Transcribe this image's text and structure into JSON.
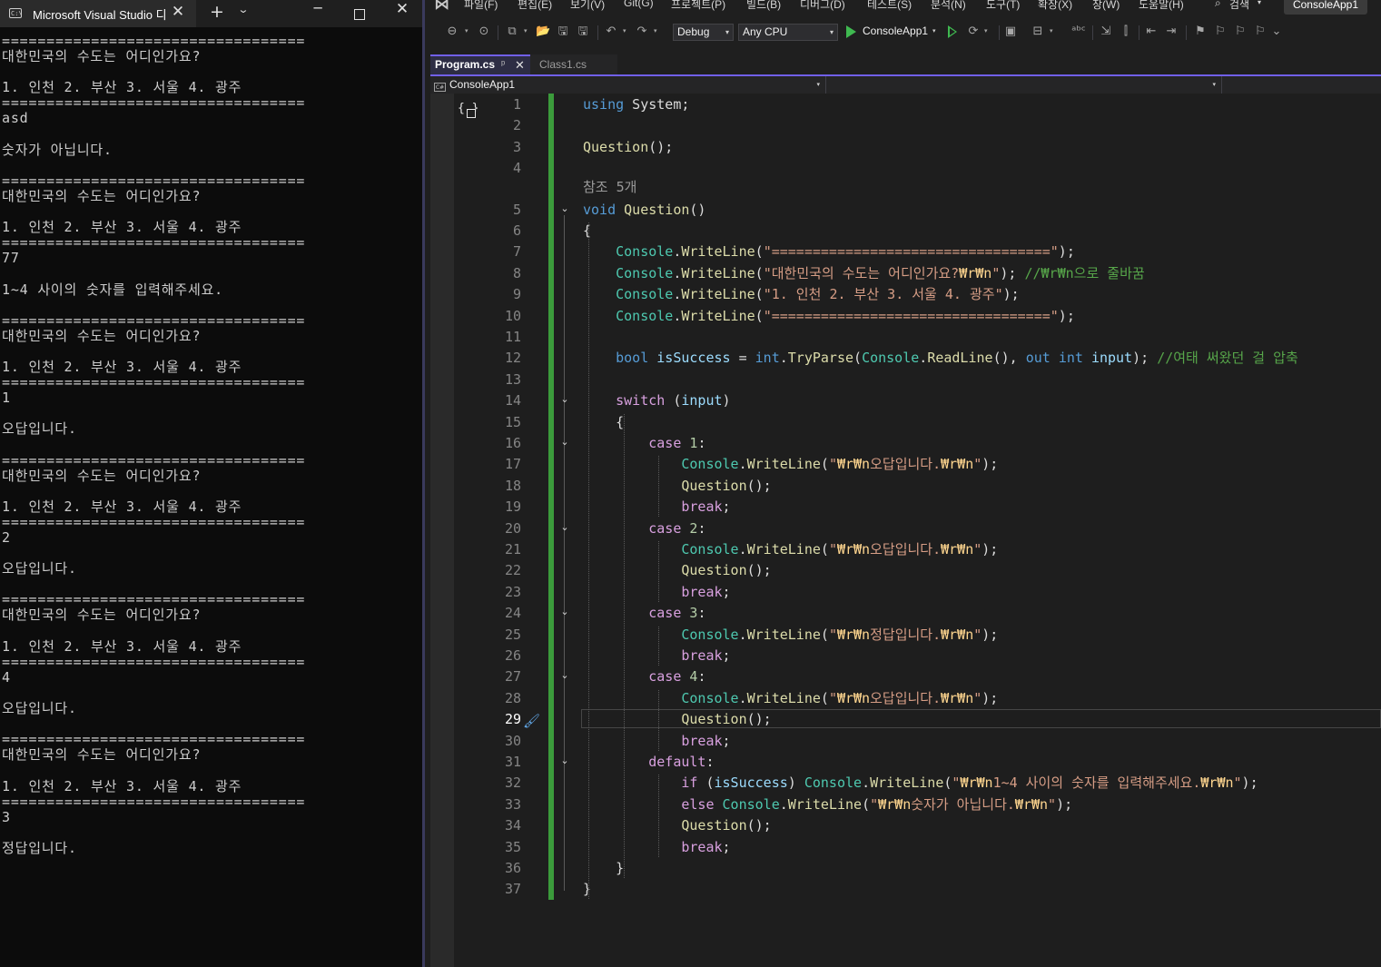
{
  "console": {
    "tab_title": "Microsoft Visual Studio 디",
    "tab_icon_text": "C:\\",
    "close_glyph": "✕",
    "new_tab_glyph": "+",
    "dropdown_glyph": "⌄",
    "minimize_glyph": "─",
    "close_window_glyph": "✕",
    "output": "==================================\n대한민국의 수도는 어디인가요?\n\n1. 인천 2. 부산 3. 서울 4. 광주\n==================================\nasd\n\n숫자가 아닙니다.\n\n==================================\n대한민국의 수도는 어디인가요?\n\n1. 인천 2. 부산 3. 서울 4. 광주\n==================================\n77\n\n1~4 사이의 숫자를 입력해주세요.\n\n==================================\n대한민국의 수도는 어디인가요?\n\n1. 인천 2. 부산 3. 서울 4. 광주\n==================================\n1\n\n오답입니다.\n\n==================================\n대한민국의 수도는 어디인가요?\n\n1. 인천 2. 부산 3. 서울 4. 광주\n==================================\n2\n\n오답입니다.\n\n==================================\n대한민국의 수도는 어디인가요?\n\n1. 인천 2. 부산 3. 서울 4. 광주\n==================================\n4\n\n오답입니다.\n\n==================================\n대한민국의 수도는 어디인가요?\n\n1. 인천 2. 부산 3. 서울 4. 광주\n==================================\n3\n\n정답입니다."
  },
  "vs": {
    "logo_glyph": "⋈",
    "menu": [
      "파일(F)",
      "편집(E)",
      "보기(V)",
      "Git(G)",
      "프로젝트(P)",
      "빌드(B)",
      "디버그(D)",
      "테스트(S)",
      "분석(N)",
      "도구(T)",
      "확장(X)",
      "창(W)",
      "도움말(H)"
    ],
    "search_label": "검색",
    "search_glyph": "⌕",
    "chev_glyph": "▾",
    "solution_name": "ConsoleApp1",
    "toolbar": {
      "config": "Debug",
      "platform": "Any CPU",
      "run_target": "ConsoleApp1",
      "icon_glyphs": {
        "back": "⊖",
        "forward": "⊙",
        "new_item": "⧉",
        "open": "📂",
        "save": "🖫",
        "save_all": "🖫",
        "undo": "↶",
        "redo": "↷",
        "attach": "⟳",
        "solution_explorer": "▣",
        "layout": "⊟",
        "spell": "ᵃᵇᶜ",
        "step": "⇲",
        "panes": "⫿",
        "indent": "⇤",
        "outdent": "⇥",
        "bookmark": "⚑",
        "prev_bookmark": "⚐",
        "next_bookmark": "⚐",
        "clear_bookmark": "⚐",
        "more": "⌄"
      }
    },
    "tabs": [
      {
        "label": "Program.cs",
        "pin": "ᵖ",
        "close": "✕"
      },
      {
        "label": "Class1.cs"
      }
    ],
    "nav": {
      "project": "ConsoleApp1",
      "cs_badge": "C#",
      "member": ""
    },
    "editor": {
      "gutter_glyph": "{ }",
      "codelens": "참조 5개",
      "current_line": 29,
      "line_numbers": [
        "1",
        "2",
        "3",
        "4",
        "5",
        "6",
        "7",
        "8",
        "9",
        "10",
        "11",
        "12",
        "13",
        "14",
        "15",
        "16",
        "17",
        "18",
        "19",
        "20",
        "21",
        "22",
        "23",
        "24",
        "25",
        "26",
        "27",
        "28",
        "29",
        "30",
        "31",
        "32",
        "33",
        "34",
        "35",
        "36",
        "37"
      ],
      "fold_glyph": "⌄",
      "brush_glyph": "🖌",
      "lines": [
        [
          [
            "kw",
            "using"
          ],
          [
            "pl",
            " System;"
          ]
        ],
        [],
        [
          [
            "mth",
            "Question"
          ],
          [
            "pl",
            "();"
          ]
        ],
        [],
        [
          [
            "kw",
            "void"
          ],
          [
            "pl",
            " "
          ],
          [
            "mth",
            "Question"
          ],
          [
            "pl",
            "()"
          ]
        ],
        [
          [
            "pl",
            "{"
          ]
        ],
        [
          [
            "pl",
            "    "
          ],
          [
            "cls",
            "Console"
          ],
          [
            "pl",
            "."
          ],
          [
            "mth",
            "WriteLine"
          ],
          [
            "pl",
            "("
          ],
          [
            "str",
            "\"==================================\""
          ],
          [
            "pl",
            ");"
          ]
        ],
        [
          [
            "pl",
            "    "
          ],
          [
            "cls",
            "Console"
          ],
          [
            "pl",
            "."
          ],
          [
            "mth",
            "WriteLine"
          ],
          [
            "pl",
            "("
          ],
          [
            "str",
            "\"대한민국의 수도는 어디인가요?"
          ],
          [
            "esc",
            "₩r₩n"
          ],
          [
            "str",
            "\""
          ],
          [
            "pl",
            "); "
          ],
          [
            "cmt",
            "//₩r₩n으로 줄바꿈"
          ]
        ],
        [
          [
            "pl",
            "    "
          ],
          [
            "cls",
            "Console"
          ],
          [
            "pl",
            "."
          ],
          [
            "mth",
            "WriteLine"
          ],
          [
            "pl",
            "("
          ],
          [
            "str",
            "\"1. 인천 2. 부산 3. 서울 4. 광주\""
          ],
          [
            "pl",
            ");"
          ]
        ],
        [
          [
            "pl",
            "    "
          ],
          [
            "cls",
            "Console"
          ],
          [
            "pl",
            "."
          ],
          [
            "mth",
            "WriteLine"
          ],
          [
            "pl",
            "("
          ],
          [
            "str",
            "\"==================================\""
          ],
          [
            "pl",
            ");"
          ]
        ],
        [],
        [
          [
            "pl",
            "    "
          ],
          [
            "kw",
            "bool"
          ],
          [
            "pl",
            " "
          ],
          [
            "var",
            "isSuccess"
          ],
          [
            "pl",
            " = "
          ],
          [
            "kw",
            "int"
          ],
          [
            "pl",
            "."
          ],
          [
            "mth",
            "TryParse"
          ],
          [
            "pl",
            "("
          ],
          [
            "cls",
            "Console"
          ],
          [
            "pl",
            "."
          ],
          [
            "mth",
            "ReadLine"
          ],
          [
            "pl",
            "(), "
          ],
          [
            "kw",
            "out"
          ],
          [
            "pl",
            " "
          ],
          [
            "kw",
            "int"
          ],
          [
            "pl",
            " "
          ],
          [
            "var",
            "input"
          ],
          [
            "pl",
            "); "
          ],
          [
            "cmt",
            "//여태 써왔던 걸 압축"
          ]
        ],
        [],
        [
          [
            "pl",
            "    "
          ],
          [
            "ctl",
            "switch"
          ],
          [
            "pl",
            " ("
          ],
          [
            "var",
            "input"
          ],
          [
            "pl",
            ")"
          ]
        ],
        [
          [
            "pl",
            "    {"
          ]
        ],
        [
          [
            "pl",
            "        "
          ],
          [
            "ctl",
            "case"
          ],
          [
            "pl",
            " "
          ],
          [
            "num",
            "1"
          ],
          [
            "pl",
            ":"
          ]
        ],
        [
          [
            "pl",
            "            "
          ],
          [
            "cls",
            "Console"
          ],
          [
            "pl",
            "."
          ],
          [
            "mth",
            "WriteLine"
          ],
          [
            "pl",
            "("
          ],
          [
            "str",
            "\""
          ],
          [
            "esc",
            "₩r₩n"
          ],
          [
            "str",
            "오답입니다."
          ],
          [
            "esc",
            "₩r₩n"
          ],
          [
            "str",
            "\""
          ],
          [
            "pl",
            ");"
          ]
        ],
        [
          [
            "pl",
            "            "
          ],
          [
            "mth",
            "Question"
          ],
          [
            "pl",
            "();"
          ]
        ],
        [
          [
            "pl",
            "            "
          ],
          [
            "ctl",
            "break"
          ],
          [
            "pl",
            ";"
          ]
        ],
        [
          [
            "pl",
            "        "
          ],
          [
            "ctl",
            "case"
          ],
          [
            "pl",
            " "
          ],
          [
            "num",
            "2"
          ],
          [
            "pl",
            ":"
          ]
        ],
        [
          [
            "pl",
            "            "
          ],
          [
            "cls",
            "Console"
          ],
          [
            "pl",
            "."
          ],
          [
            "mth",
            "WriteLine"
          ],
          [
            "pl",
            "("
          ],
          [
            "str",
            "\""
          ],
          [
            "esc",
            "₩r₩n"
          ],
          [
            "str",
            "오답입니다."
          ],
          [
            "esc",
            "₩r₩n"
          ],
          [
            "str",
            "\""
          ],
          [
            "pl",
            ");"
          ]
        ],
        [
          [
            "pl",
            "            "
          ],
          [
            "mth",
            "Question"
          ],
          [
            "pl",
            "();"
          ]
        ],
        [
          [
            "pl",
            "            "
          ],
          [
            "ctl",
            "break"
          ],
          [
            "pl",
            ";"
          ]
        ],
        [
          [
            "pl",
            "        "
          ],
          [
            "ctl",
            "case"
          ],
          [
            "pl",
            " "
          ],
          [
            "num",
            "3"
          ],
          [
            "pl",
            ":"
          ]
        ],
        [
          [
            "pl",
            "            "
          ],
          [
            "cls",
            "Console"
          ],
          [
            "pl",
            "."
          ],
          [
            "mth",
            "WriteLine"
          ],
          [
            "pl",
            "("
          ],
          [
            "str",
            "\""
          ],
          [
            "esc",
            "₩r₩n"
          ],
          [
            "str",
            "정답입니다."
          ],
          [
            "esc",
            "₩r₩n"
          ],
          [
            "str",
            "\""
          ],
          [
            "pl",
            ");"
          ]
        ],
        [
          [
            "pl",
            "            "
          ],
          [
            "ctl",
            "break"
          ],
          [
            "pl",
            ";"
          ]
        ],
        [
          [
            "pl",
            "        "
          ],
          [
            "ctl",
            "case"
          ],
          [
            "pl",
            " "
          ],
          [
            "num",
            "4"
          ],
          [
            "pl",
            ":"
          ]
        ],
        [
          [
            "pl",
            "            "
          ],
          [
            "cls",
            "Console"
          ],
          [
            "pl",
            "."
          ],
          [
            "mth",
            "WriteLine"
          ],
          [
            "pl",
            "("
          ],
          [
            "str",
            "\""
          ],
          [
            "esc",
            "₩r₩n"
          ],
          [
            "str",
            "오답입니다."
          ],
          [
            "esc",
            "₩r₩n"
          ],
          [
            "str",
            "\""
          ],
          [
            "pl",
            ");"
          ]
        ],
        [
          [
            "pl",
            "            "
          ],
          [
            "mth",
            "Question"
          ],
          [
            "pl",
            "();"
          ]
        ],
        [
          [
            "pl",
            "            "
          ],
          [
            "ctl",
            "break"
          ],
          [
            "pl",
            ";"
          ]
        ],
        [
          [
            "pl",
            "        "
          ],
          [
            "ctl",
            "default"
          ],
          [
            "pl",
            ":"
          ]
        ],
        [
          [
            "pl",
            "            "
          ],
          [
            "ctl",
            "if"
          ],
          [
            "pl",
            " ("
          ],
          [
            "var",
            "isSuccess"
          ],
          [
            "pl",
            ") "
          ],
          [
            "cls",
            "Console"
          ],
          [
            "pl",
            "."
          ],
          [
            "mth",
            "WriteLine"
          ],
          [
            "pl",
            "("
          ],
          [
            "str",
            "\""
          ],
          [
            "esc",
            "₩r₩n"
          ],
          [
            "str",
            "1~4 사이의 숫자를 입력해주세요."
          ],
          [
            "esc",
            "₩r₩n"
          ],
          [
            "str",
            "\""
          ],
          [
            "pl",
            ");"
          ]
        ],
        [
          [
            "pl",
            "            "
          ],
          [
            "ctl",
            "else"
          ],
          [
            "pl",
            " "
          ],
          [
            "cls",
            "Console"
          ],
          [
            "pl",
            "."
          ],
          [
            "mth",
            "WriteLine"
          ],
          [
            "pl",
            "("
          ],
          [
            "str",
            "\""
          ],
          [
            "esc",
            "₩r₩n"
          ],
          [
            "str",
            "숫자가 아닙니다."
          ],
          [
            "esc",
            "₩r₩n"
          ],
          [
            "str",
            "\""
          ],
          [
            "pl",
            ");"
          ]
        ],
        [
          [
            "pl",
            "            "
          ],
          [
            "mth",
            "Question"
          ],
          [
            "pl",
            "();"
          ]
        ],
        [
          [
            "pl",
            "            "
          ],
          [
            "ctl",
            "break"
          ],
          [
            "pl",
            ";"
          ]
        ],
        [
          [
            "pl",
            "    }"
          ]
        ],
        [
          [
            "pl",
            "}"
          ]
        ]
      ]
    }
  }
}
